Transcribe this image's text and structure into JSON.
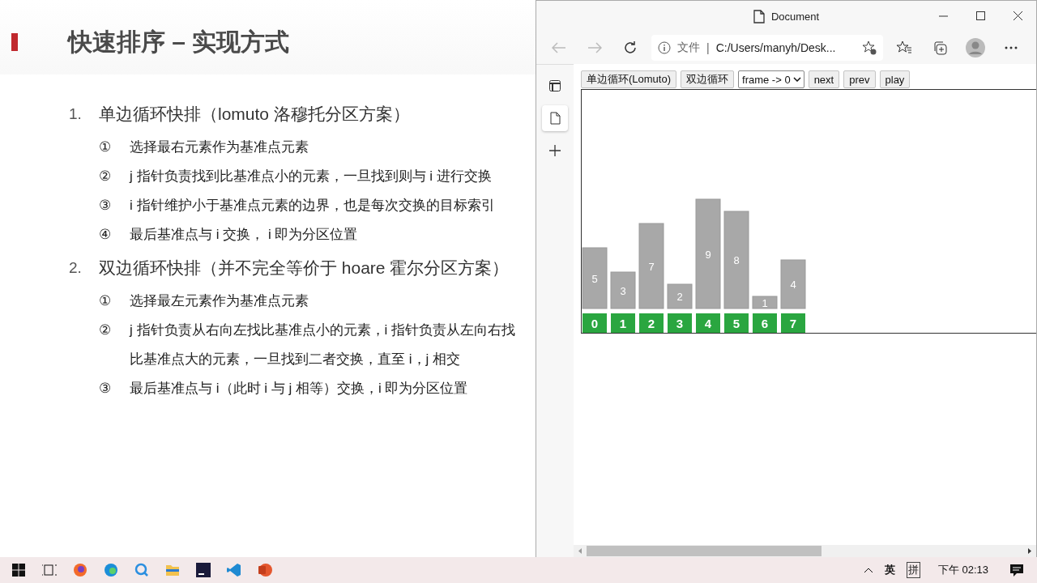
{
  "slide": {
    "title": "快速排序 – 实现方式",
    "sections": [
      {
        "number": "1.",
        "text": "单边循环快排（lomuto 洛穆托分区方案）",
        "steps": [
          {
            "marker": "①",
            "text": "选择最右元素作为基准点元素"
          },
          {
            "marker": "②",
            "text": "j 指针负责找到比基准点小的元素，一旦找到则与 i 进行交换"
          },
          {
            "marker": "③",
            "text": "i 指针维护小于基准点元素的边界，也是每次交换的目标索引"
          },
          {
            "marker": "④",
            "text": "最后基准点与 i 交换， i 即为分区位置"
          }
        ]
      },
      {
        "number": "2.",
        "text": "双边循环快排（并不完全等价于 hoare 霍尔分区方案）",
        "steps": [
          {
            "marker": "①",
            "text": "选择最左元素作为基准点元素"
          },
          {
            "marker": "②",
            "text": "j 指针负责从右向左找比基准点小的元素，i 指针负责从左向右找比基准点大的元素，一旦找到二者交换，直至 i，j 相交"
          },
          {
            "marker": "③",
            "text": "最后基准点与 i（此时 i 与 j 相等）交换，i 即为分区位置"
          }
        ]
      }
    ]
  },
  "browser": {
    "title": "Document",
    "address_prefix": "文件",
    "address_separator": "|",
    "url": "C:/Users/manyh/Desk...",
    "controls": [
      {
        "kind": "button",
        "label": "单边循环(Lomuto)"
      },
      {
        "kind": "button",
        "label": "双边循环"
      },
      {
        "kind": "select",
        "label": "frame -> 0"
      },
      {
        "kind": "button",
        "label": "next"
      },
      {
        "kind": "button",
        "label": "prev"
      },
      {
        "kind": "button",
        "label": "play"
      }
    ],
    "chart_data": {
      "type": "bar",
      "categories": [
        "0",
        "1",
        "2",
        "3",
        "4",
        "5",
        "6",
        "7"
      ],
      "values": [
        5,
        3,
        7,
        2,
        9,
        8,
        1,
        4
      ],
      "data_labels": true
    }
  },
  "taskbar": {
    "language": "英",
    "ime": "拼",
    "clock": "下午 02:13"
  }
}
